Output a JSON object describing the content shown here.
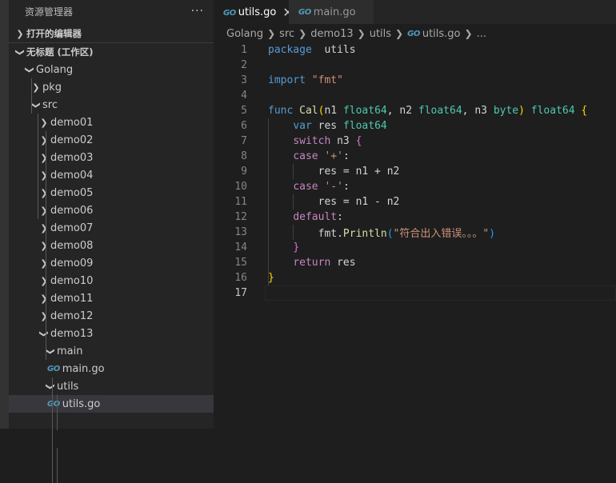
{
  "sidebar": {
    "title": "资源管理器",
    "more": "···",
    "open_editors": "打开的编辑器",
    "workspace": "无标题 (工作区)",
    "tree": [
      {
        "label": "Golang",
        "depth": 0,
        "type": "folder",
        "expanded": true
      },
      {
        "label": "pkg",
        "depth": 1,
        "type": "folder",
        "expanded": false
      },
      {
        "label": "src",
        "depth": 1,
        "type": "folder",
        "expanded": true
      },
      {
        "label": "demo01",
        "depth": 2,
        "type": "folder",
        "expanded": false
      },
      {
        "label": "demo02",
        "depth": 2,
        "type": "folder",
        "expanded": false
      },
      {
        "label": "demo03",
        "depth": 2,
        "type": "folder",
        "expanded": false
      },
      {
        "label": "demo04",
        "depth": 2,
        "type": "folder",
        "expanded": false
      },
      {
        "label": "demo05",
        "depth": 2,
        "type": "folder",
        "expanded": false
      },
      {
        "label": "demo06",
        "depth": 2,
        "type": "folder",
        "expanded": false
      },
      {
        "label": "demo07",
        "depth": 2,
        "type": "folder",
        "expanded": false
      },
      {
        "label": "demo08",
        "depth": 2,
        "type": "folder",
        "expanded": false
      },
      {
        "label": "demo09",
        "depth": 2,
        "type": "folder",
        "expanded": false
      },
      {
        "label": "demo10",
        "depth": 2,
        "type": "folder",
        "expanded": false
      },
      {
        "label": "demo11",
        "depth": 2,
        "type": "folder",
        "expanded": false
      },
      {
        "label": "demo12",
        "depth": 2,
        "type": "folder",
        "expanded": false
      },
      {
        "label": "demo13",
        "depth": 2,
        "type": "folder",
        "expanded": true
      },
      {
        "label": "main",
        "depth": 3,
        "type": "folder",
        "expanded": true
      },
      {
        "label": "main.go",
        "depth": 4,
        "type": "file"
      },
      {
        "label": "utils",
        "depth": 3,
        "type": "folder",
        "expanded": true
      },
      {
        "label": "utils.go",
        "depth": 4,
        "type": "file",
        "selected": true
      }
    ]
  },
  "file_icon_text": "GO",
  "tabs": [
    {
      "label": "utils.go",
      "active": true,
      "close": "✕"
    },
    {
      "label": "main.go",
      "active": false
    }
  ],
  "breadcrumb": [
    "Golang",
    "src",
    "demo13",
    "utils",
    "utils.go",
    "..."
  ],
  "editor": {
    "current_line": 17,
    "lines": [
      {
        "n": "1",
        "t": [
          [
            "kw",
            "package"
          ],
          [
            "",
            "  utils"
          ]
        ]
      },
      {
        "n": "2",
        "t": []
      },
      {
        "n": "3",
        "t": [
          [
            "kw",
            "import"
          ],
          [
            "",
            " "
          ],
          [
            "str",
            "\"fmt\""
          ]
        ]
      },
      {
        "n": "4",
        "t": []
      },
      {
        "n": "5",
        "t": [
          [
            "kw",
            "func"
          ],
          [
            "",
            " "
          ],
          [
            "fn",
            "Cal"
          ],
          [
            "b1",
            "("
          ],
          [
            "",
            "n1 "
          ],
          [
            "ty",
            "float64"
          ],
          [
            "",
            ", n2 "
          ],
          [
            "ty",
            "float64"
          ],
          [
            "",
            ", n3 "
          ],
          [
            "ty",
            "byte"
          ],
          [
            "b1",
            ")"
          ],
          [
            "",
            " "
          ],
          [
            "ty",
            "float64"
          ],
          [
            "",
            " "
          ],
          [
            "b1",
            "{"
          ]
        ]
      },
      {
        "n": "6",
        "t": [
          [
            "",
            "    "
          ],
          [
            "kw",
            "var"
          ],
          [
            "",
            " res "
          ],
          [
            "ty",
            "float64"
          ]
        ]
      },
      {
        "n": "7",
        "t": [
          [
            "",
            "    "
          ],
          [
            "ctl",
            "switch"
          ],
          [
            "",
            " n3 "
          ],
          [
            "b2",
            "{"
          ]
        ]
      },
      {
        "n": "8",
        "t": [
          [
            "",
            "    "
          ],
          [
            "ctl",
            "case"
          ],
          [
            "",
            " "
          ],
          [
            "str",
            "'+'"
          ],
          [
            "",
            ":"
          ]
        ]
      },
      {
        "n": "9",
        "t": [
          [
            "",
            "        res = n1 + n2"
          ]
        ]
      },
      {
        "n": "10",
        "t": [
          [
            "",
            "    "
          ],
          [
            "ctl",
            "case"
          ],
          [
            "",
            " "
          ],
          [
            "str",
            "'-'"
          ],
          [
            "",
            ":"
          ]
        ]
      },
      {
        "n": "11",
        "t": [
          [
            "",
            "        res = n1 - n2"
          ]
        ]
      },
      {
        "n": "12",
        "t": [
          [
            "",
            "    "
          ],
          [
            "ctl",
            "default"
          ],
          [
            "",
            ":"
          ]
        ]
      },
      {
        "n": "13",
        "t": [
          [
            "",
            "        fmt."
          ],
          [
            "fn",
            "Println"
          ],
          [
            "b3",
            "("
          ],
          [
            "str",
            "\"符合出入错误。。。\""
          ],
          [
            "b3",
            ")"
          ]
        ]
      },
      {
        "n": "14",
        "t": [
          [
            "",
            "    "
          ],
          [
            "b2",
            "}"
          ]
        ]
      },
      {
        "n": "15",
        "t": [
          [
            "",
            "    "
          ],
          [
            "ctl",
            "return"
          ],
          [
            "",
            " res"
          ]
        ]
      },
      {
        "n": "16",
        "t": [
          [
            "b1",
            "}"
          ]
        ]
      },
      {
        "n": "17",
        "t": []
      }
    ]
  }
}
